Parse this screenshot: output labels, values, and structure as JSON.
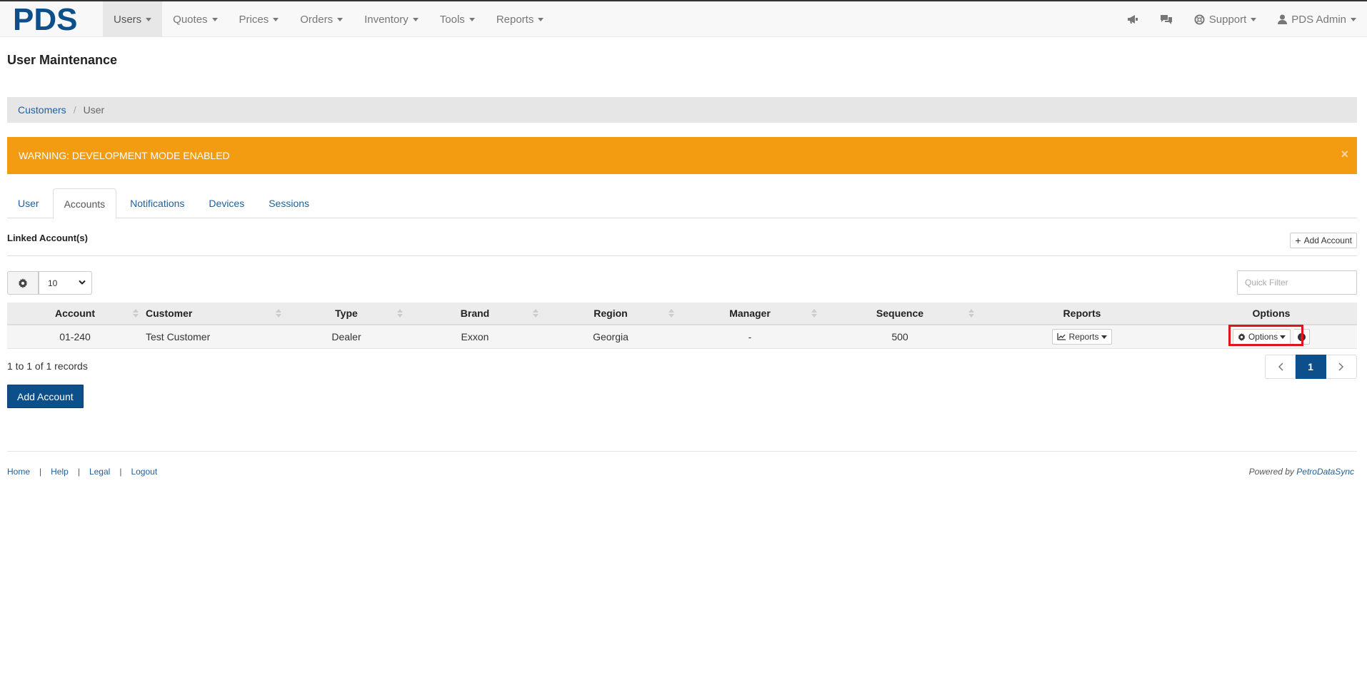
{
  "brand": {
    "logo_text": "PDS",
    "logo_color": "#0d4f8b"
  },
  "nav": {
    "items": [
      {
        "label": "Users",
        "active": true
      },
      {
        "label": "Quotes"
      },
      {
        "label": "Prices"
      },
      {
        "label": "Orders"
      },
      {
        "label": "Inventory"
      },
      {
        "label": "Tools"
      },
      {
        "label": "Reports"
      }
    ],
    "right": {
      "announcements_icon": "bullhorn-icon",
      "chat_icon": "comments-icon",
      "support_label": "Support",
      "user_label": "PDS Admin"
    }
  },
  "page": {
    "title": "User Maintenance"
  },
  "breadcrumb": {
    "parent": "Customers",
    "current": "User"
  },
  "alert": {
    "text": "WARNING: DEVELOPMENT MODE ENABLED",
    "close": "×",
    "color": "#f39c12"
  },
  "tabs": [
    "User",
    "Accounts",
    "Notifications",
    "Devices",
    "Sessions"
  ],
  "active_tab": "Accounts",
  "section": {
    "title": "Linked Account(s)",
    "add_button": "Add Account"
  },
  "table_controls": {
    "page_size": "10",
    "quick_filter_placeholder": "Quick Filter"
  },
  "table": {
    "headers": [
      "Account",
      "Customer",
      "Type",
      "Brand",
      "Region",
      "Manager",
      "Sequence",
      "Reports",
      "Options"
    ],
    "rows": [
      {
        "account": "01-240",
        "customer": "Test Customer",
        "type": "Dealer",
        "brand": "Exxon",
        "region": "Georgia",
        "manager": "-",
        "sequence": "500",
        "reports_btn": "Reports",
        "options_btn": "Options"
      }
    ]
  },
  "records_text": "1 to 1 of 1 records",
  "pagination": {
    "current": "1"
  },
  "add_account_button": "Add Account",
  "footer": {
    "links": [
      "Home",
      "Help",
      "Legal",
      "Logout"
    ],
    "powered_prefix": "Powered by",
    "powered_link": "PetroDataSync"
  },
  "colors": {
    "primary": "#0d4f8b",
    "link": "#1f5f9a",
    "highlight": "#e0141e"
  }
}
